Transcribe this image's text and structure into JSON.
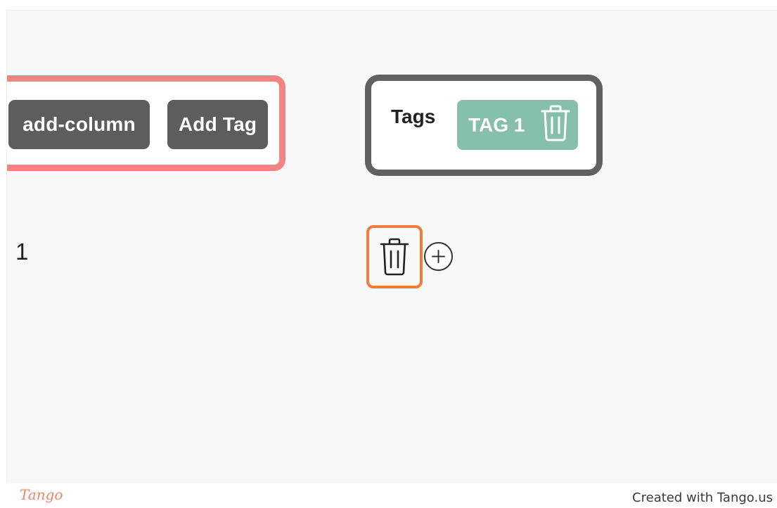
{
  "toolbar": {
    "add_column_label": "add-column",
    "add_tag_label": "Add Tag"
  },
  "tags_panel": {
    "label": "Tags",
    "chips": [
      {
        "label": "TAG 1",
        "icon": "trash-icon"
      }
    ]
  },
  "row": {
    "number": "1",
    "delete_icon": "trash-icon",
    "add_icon": "plus-circle-icon"
  },
  "footer": {
    "logo": "Tango",
    "credit": "Created with Tango.us"
  },
  "colors": {
    "toolbar_highlight": "#f28484",
    "button_bg": "#5d5d5d",
    "tag_chip_bg": "#86bfac",
    "click_highlight": "#f27a3a"
  }
}
